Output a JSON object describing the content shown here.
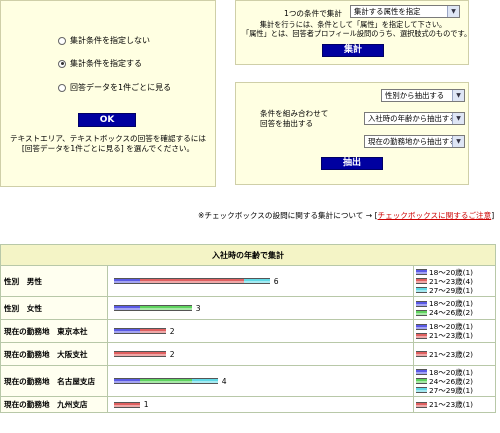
{
  "left_panel": {
    "options": [
      {
        "label": "集計条件を指定しない",
        "checked": false
      },
      {
        "label": "集計条件を指定する",
        "checked": true
      },
      {
        "label": "回答データを1件ごとに見る",
        "checked": false
      }
    ],
    "ok_label": "OK",
    "note_line1": "テキストエリア、テキストボックスの回答を確認するには",
    "note_line2": "[回答データを1件ごとに見る] を選んでください。"
  },
  "single_condition": {
    "label": "1つの条件で集計",
    "select_value": "集計する属性を指定",
    "note_line1": "集計を行うには、条件として「属性」を指定して下さい。",
    "note_line2": "「属性」とは、回答者プロフィール設問のうち、選択肢式のものです。",
    "button_label": "集計"
  },
  "combined_condition": {
    "label_line1": "条件を組み合わせて",
    "label_line2": "回答を抽出する",
    "selects": [
      "性別から抽出する",
      "入社時の年齢から抽出する",
      "現在の勤務地から抽出する"
    ],
    "button_label": "抽出"
  },
  "checkbox_note": {
    "text": "※チェックボックスの設問に関する集計について → [",
    "link": "チェックボックスに関するご注意",
    "close": "]"
  },
  "table": {
    "title": "入社時の年齢で集計",
    "colors": {
      "blue": "#5a5ae6",
      "red": "#e06060",
      "green": "#5ed35e",
      "cyan": "#5fd9e6"
    },
    "rows": [
      {
        "label": "性別　男性",
        "total": "6",
        "segments": [
          {
            "color": "blue",
            "count": 1
          },
          {
            "color": "red",
            "count": 4
          },
          {
            "color": "cyan",
            "count": 1
          }
        ],
        "legend": [
          {
            "color": "blue",
            "text": "18～20歳(1)"
          },
          {
            "color": "red",
            "text": "21～23歳(4)"
          },
          {
            "color": "cyan",
            "text": "27～29歳(1)"
          }
        ]
      },
      {
        "label": "性別　女性",
        "total": "3",
        "segments": [
          {
            "color": "blue",
            "count": 1
          },
          {
            "color": "green",
            "count": 2
          }
        ],
        "legend": [
          {
            "color": "blue",
            "text": "18～20歳(1)"
          },
          {
            "color": "green",
            "text": "24～26歳(2)"
          }
        ]
      },
      {
        "label": "現在の勤務地　東京本社",
        "total": "2",
        "segments": [
          {
            "color": "blue",
            "count": 1
          },
          {
            "color": "red",
            "count": 1
          }
        ],
        "legend": [
          {
            "color": "blue",
            "text": "18～20歳(1)"
          },
          {
            "color": "red",
            "text": "21～23歳(1)"
          }
        ]
      },
      {
        "label": "現在の勤務地　大阪支社",
        "total": "2",
        "segments": [
          {
            "color": "red",
            "count": 2
          }
        ],
        "legend": [
          {
            "color": "red",
            "text": "21～23歳(2)"
          }
        ]
      },
      {
        "label": "現在の勤務地　名古屋支店",
        "total": "4",
        "segments": [
          {
            "color": "blue",
            "count": 1
          },
          {
            "color": "green",
            "count": 2
          },
          {
            "color": "cyan",
            "count": 1
          }
        ],
        "legend": [
          {
            "color": "blue",
            "text": "18～20歳(1)"
          },
          {
            "color": "green",
            "text": "24～26歳(2)"
          },
          {
            "color": "cyan",
            "text": "27～29歳(1)"
          }
        ]
      },
      {
        "label": "現在の勤務地　九州支店",
        "total": "1",
        "segments": [
          {
            "color": "red",
            "count": 1
          }
        ],
        "legend": [
          {
            "color": "red",
            "text": "21～23歳(1)"
          }
        ]
      }
    ]
  }
}
